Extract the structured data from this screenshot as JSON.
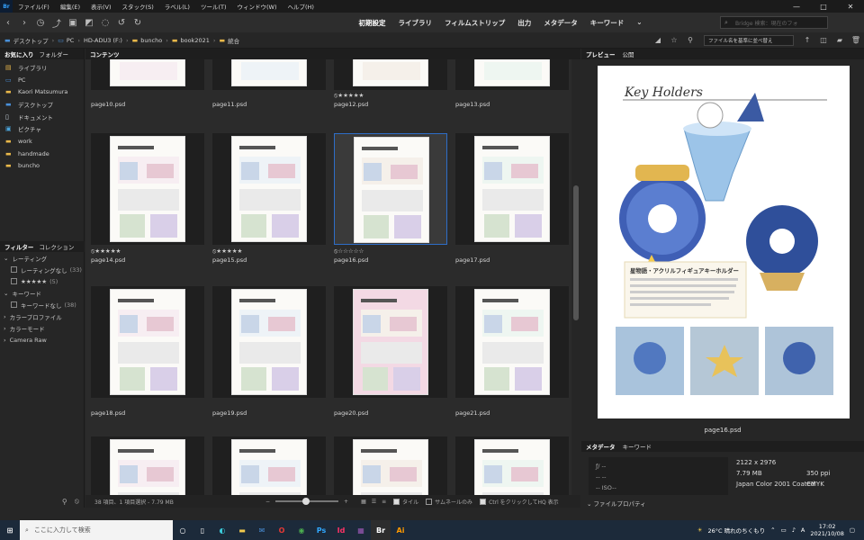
{
  "menu": {
    "logo": "Br",
    "items": [
      "ファイル(F)",
      "編集(E)",
      "表示(V)",
      "スタック(S)",
      "ラベル(L)",
      "ツール(T)",
      "ウィンドウ(W)",
      "ヘルプ(H)"
    ],
    "window_controls": [
      "—",
      "□",
      "✕"
    ]
  },
  "workspaces": [
    "初期設定",
    "ライブラリ",
    "フィルムストリップ",
    "出力",
    "メタデータ",
    "キーワード"
  ],
  "search_placeholder": "Bridge 検索：現在のフォ",
  "path": {
    "desktop": "デスクトップ",
    "pc": "PC",
    "drive": "HD-ADU3 (F:)",
    "folder1": "buncho",
    "folder2": "book2021",
    "folder3": "統合"
  },
  "sort_label": "ファイル名を基準に並べ替え",
  "favorites_panel": {
    "tab_active": "お気に入り",
    "tab_other": "フォルダー",
    "items": [
      {
        "label": "ライブラリ",
        "icon": "library-icon"
      },
      {
        "label": "PC",
        "icon": "pc-icon"
      },
      {
        "label": "Kaori Matsumura",
        "icon": "folder-icon"
      },
      {
        "label": "デスクトップ",
        "icon": "folder-icon"
      },
      {
        "label": "ドキュメント",
        "icon": "folder-icon"
      },
      {
        "label": "ピクチャ",
        "icon": "folder-icon"
      },
      {
        "label": "work",
        "icon": "folder-icon"
      },
      {
        "label": "handmade",
        "icon": "folder-icon"
      },
      {
        "label": "buncho",
        "icon": "folder-icon"
      }
    ]
  },
  "filter_panel": {
    "tab_active": "フィルター",
    "tab_other": "コレクション",
    "rows": [
      {
        "label": "レーティング",
        "type": "group"
      },
      {
        "label": "レーティングなし",
        "count": "(33)",
        "type": "check"
      },
      {
        "label": "★★★★★",
        "count": "(5)",
        "type": "check"
      },
      {
        "label": "キーワード",
        "type": "group"
      },
      {
        "label": "キーワードなし",
        "count": "(38)",
        "type": "check"
      },
      {
        "label": "カラープロファイル",
        "type": "group"
      },
      {
        "label": "カラーモード",
        "type": "group"
      },
      {
        "label": "Camera Raw",
        "type": "group"
      }
    ]
  },
  "content_title": "コンテンツ",
  "thumbnails": [
    {
      "name": "page10.psd",
      "rating": ""
    },
    {
      "name": "page11.psd",
      "rating": ""
    },
    {
      "name": "page12.psd",
      "rating": "⦸★★★★★"
    },
    {
      "name": "page13.psd",
      "rating": ""
    },
    {
      "name": "page14.psd",
      "rating": "⦸★★★★★"
    },
    {
      "name": "page15.psd",
      "rating": "⦸★★★★★"
    },
    {
      "name": "page16.psd",
      "rating": "⦸☆☆☆☆☆"
    },
    {
      "name": "page17.psd",
      "rating": ""
    },
    {
      "name": "page18.psd",
      "rating": ""
    },
    {
      "name": "page19.psd",
      "rating": ""
    },
    {
      "name": "page20.psd",
      "rating": ""
    },
    {
      "name": "page21.psd",
      "rating": ""
    },
    {
      "name": "",
      "rating": ""
    },
    {
      "name": "",
      "rating": ""
    },
    {
      "name": "",
      "rating": ""
    },
    {
      "name": "",
      "rating": ""
    }
  ],
  "selected_index": 6,
  "status": "38 項目、1 項目選択 - 7.79 MB",
  "footer_options": [
    "タイル",
    "サムネールのみ",
    "Ctrl をクリックしてHQ 表示"
  ],
  "preview": {
    "tab_active": "プレビュー",
    "tab_other": "公開",
    "title": "Key Holders",
    "heading": "星物語・アクリルフィギュアキーホルダー",
    "filename": "page16.psd"
  },
  "metadata": {
    "tab_active": "メタデータ",
    "tab_other": "キーワード",
    "dimensions": "2122 x 2976",
    "size": "7.79 MB",
    "resolution": "350 ppi",
    "profile": "Japan Color 2001 Coated",
    "mode": "CMYK",
    "file_props": "ファイルプロパティ"
  },
  "taskbar": {
    "search_placeholder": "ここに入力して検索",
    "weather": "26°C 晴れのちくもり",
    "time": "17:02",
    "date": "2021/10/08"
  }
}
